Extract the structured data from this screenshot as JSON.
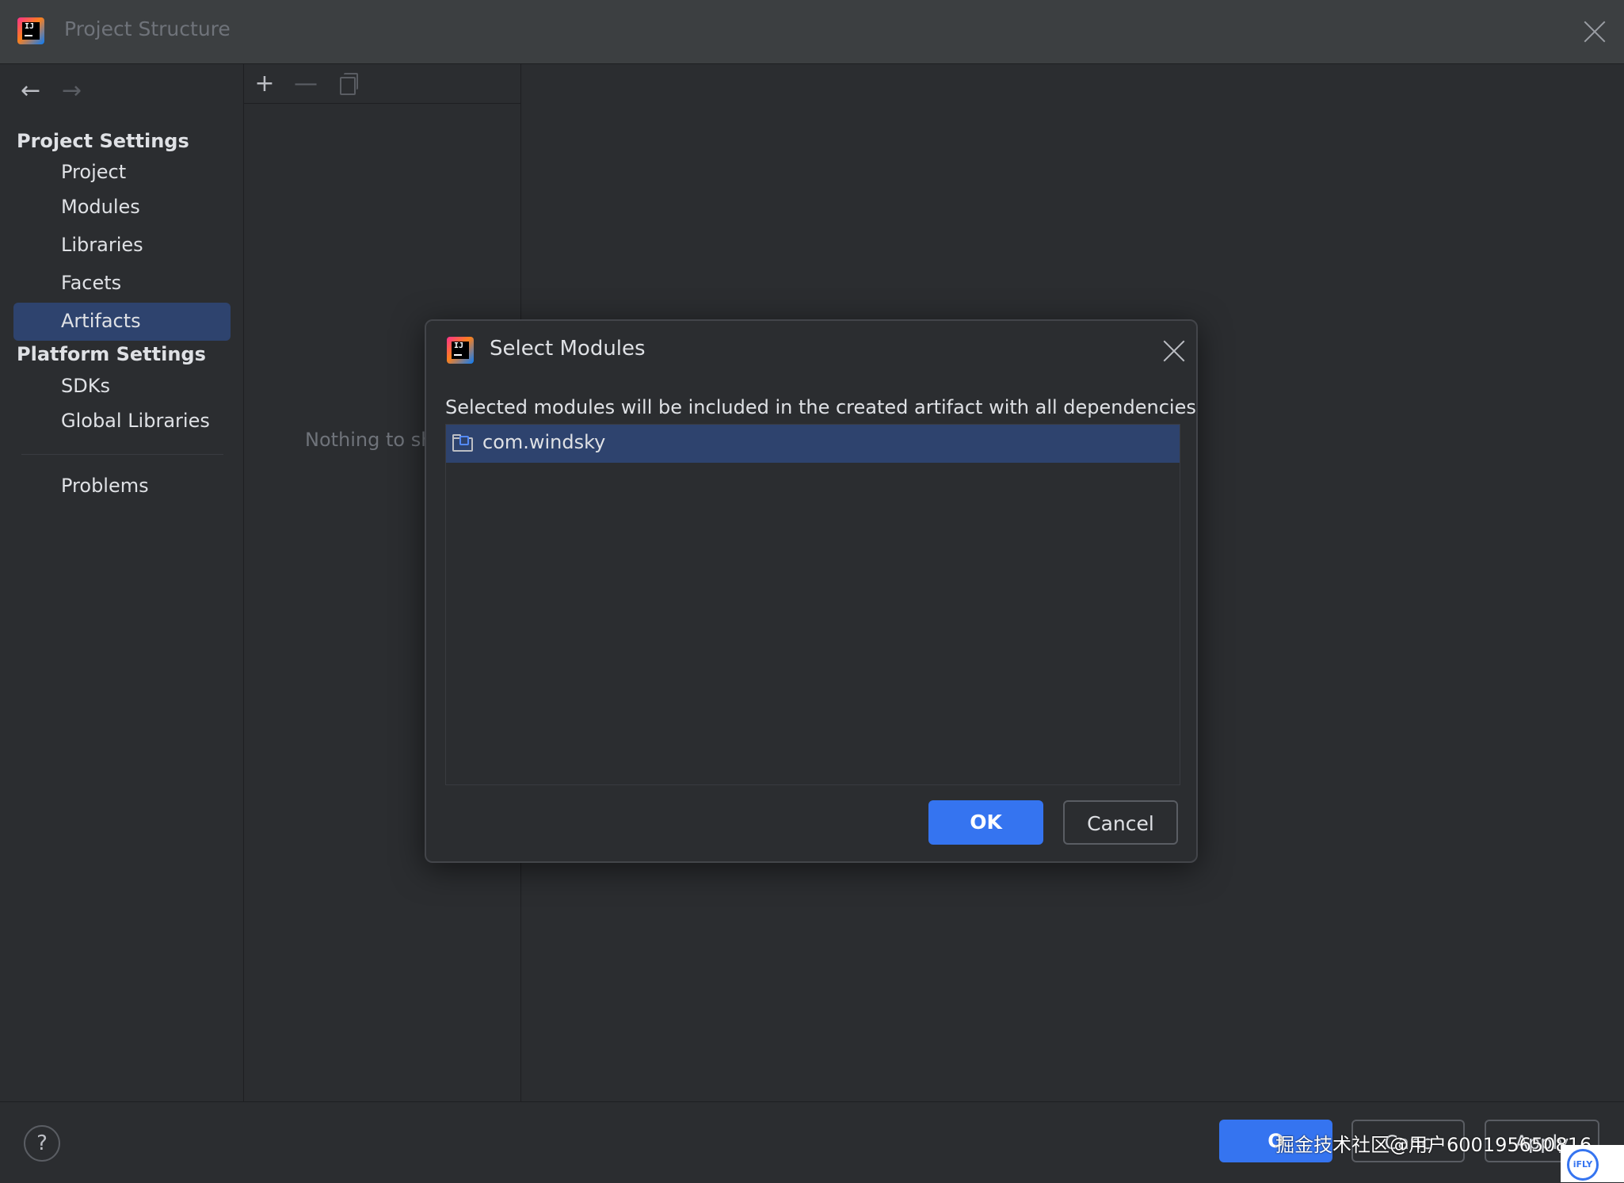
{
  "window": {
    "title": "Project Structure",
    "logo_text": "IJ"
  },
  "sidebar": {
    "project_settings_heading": "Project Settings",
    "project_items": [
      {
        "label": "Project"
      },
      {
        "label": "Modules"
      },
      {
        "label": "Libraries"
      },
      {
        "label": "Facets"
      },
      {
        "label": "Artifacts",
        "selected": true
      }
    ],
    "platform_settings_heading": "Platform Settings",
    "platform_items": [
      {
        "label": "SDKs"
      },
      {
        "label": "Global Libraries"
      }
    ],
    "problems_label": "Problems"
  },
  "list_panel": {
    "empty_text": "Nothing to sh"
  },
  "bottom_bar": {
    "ok_label": "O",
    "cancel_label": "Canc",
    "apply_label": "Apply",
    "help_label": "?"
  },
  "watermark": {
    "text": "掘金技术社区@用户600195650816",
    "badge_text": "iFLY"
  },
  "dialog": {
    "title": "Select Modules",
    "logo_text": "IJ",
    "description": "Selected modules will be included in the created artifact with all dependencies",
    "modules": [
      {
        "label": "com.windsky",
        "selected": true
      }
    ],
    "ok_label": "OK",
    "cancel_label": "Cancel"
  },
  "colors": {
    "background": "#2b2d30",
    "selection": "#2e436e",
    "accent": "#3574f0",
    "text": "#dfe1e5",
    "muted_text": "#6f737a"
  },
  "icons": {
    "back": "arrow-left-icon",
    "forward": "arrow-right-icon",
    "add": "plus-icon",
    "remove": "minus-icon",
    "copy": "copy-icon",
    "close": "close-icon",
    "module": "module-folder-icon",
    "help": "help-icon"
  }
}
